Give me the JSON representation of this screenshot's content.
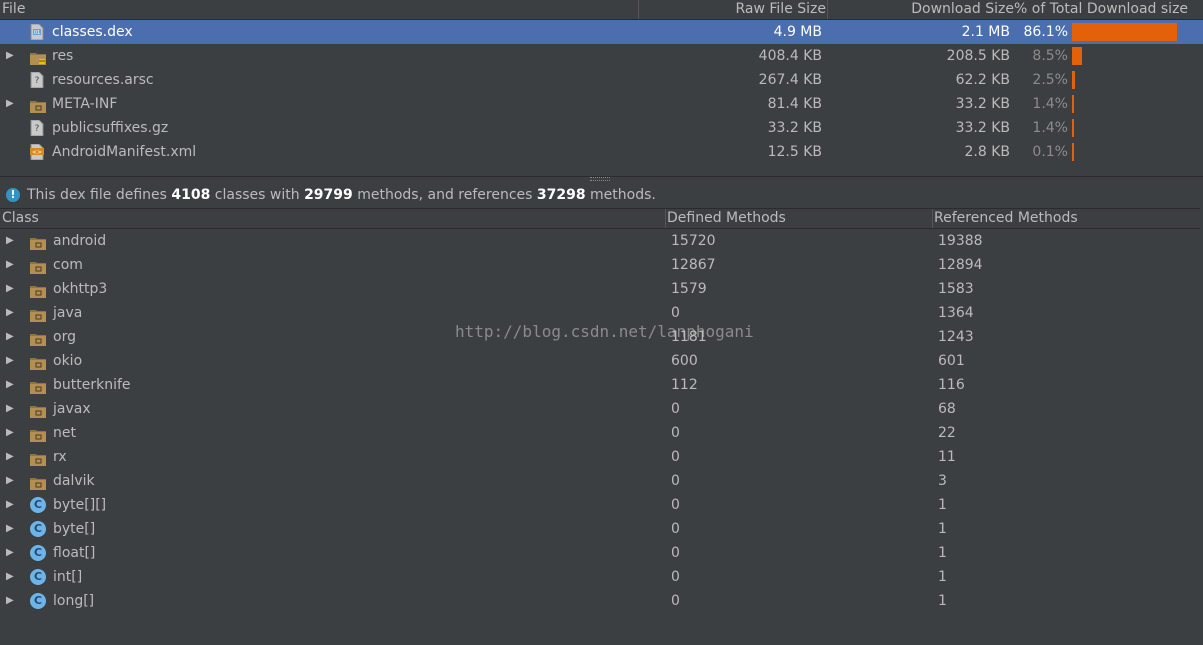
{
  "file_table": {
    "headers": {
      "file": "File",
      "raw_size": "Raw File Size",
      "download_size": "Download Size",
      "percent": "% of Total Download size"
    },
    "rows": [
      {
        "name": "classes.dex",
        "raw": "4.9 MB",
        "download": "2.1 MB",
        "percent": "86.1%",
        "fraction": 0.861,
        "expandable": false,
        "selected": true,
        "icon": "dex-file-icon"
      },
      {
        "name": "res",
        "raw": "408.4 KB",
        "download": "208.5 KB",
        "percent": "8.5%",
        "fraction": 0.085,
        "expandable": true,
        "selected": false,
        "icon": "resource-folder-icon"
      },
      {
        "name": "resources.arsc",
        "raw": "267.4 KB",
        "download": "62.2 KB",
        "percent": "2.5%",
        "fraction": 0.025,
        "expandable": false,
        "selected": false,
        "icon": "unknown-file-icon"
      },
      {
        "name": "META-INF",
        "raw": "81.4 KB",
        "download": "33.2 KB",
        "percent": "1.4%",
        "fraction": 0.014,
        "expandable": true,
        "selected": false,
        "icon": "folder-icon"
      },
      {
        "name": "publicsuffixes.gz",
        "raw": "33.2 KB",
        "download": "33.2 KB",
        "percent": "1.4%",
        "fraction": 0.014,
        "expandable": false,
        "selected": false,
        "icon": "unknown-file-icon"
      },
      {
        "name": "AndroidManifest.xml",
        "raw": "12.5 KB",
        "download": "2.8 KB",
        "percent": "0.1%",
        "fraction": 0.001,
        "expandable": false,
        "selected": false,
        "icon": "xml-file-icon"
      }
    ]
  },
  "info": {
    "t1": "This dex file defines ",
    "classes": "4108",
    "t2": " classes with ",
    "methods": "29799",
    "t3": " methods, and references ",
    "refs": "37298",
    "t4": " methods."
  },
  "class_table": {
    "headers": {
      "class": "Class",
      "defined": "Defined Methods",
      "referenced": "Referenced Methods"
    },
    "rows": [
      {
        "name": "android",
        "defined": "15720",
        "referenced": "19388",
        "kind": "package"
      },
      {
        "name": "com",
        "defined": "12867",
        "referenced": "12894",
        "kind": "package"
      },
      {
        "name": "okhttp3",
        "defined": "1579",
        "referenced": "1583",
        "kind": "package"
      },
      {
        "name": "java",
        "defined": "0",
        "referenced": "1364",
        "kind": "package"
      },
      {
        "name": "org",
        "defined": "1181",
        "referenced": "1243",
        "kind": "package"
      },
      {
        "name": "okio",
        "defined": "600",
        "referenced": "601",
        "kind": "package"
      },
      {
        "name": "butterknife",
        "defined": "112",
        "referenced": "116",
        "kind": "package"
      },
      {
        "name": "javax",
        "defined": "0",
        "referenced": "68",
        "kind": "package"
      },
      {
        "name": "net",
        "defined": "0",
        "referenced": "22",
        "kind": "package"
      },
      {
        "name": "rx",
        "defined": "0",
        "referenced": "11",
        "kind": "package"
      },
      {
        "name": "dalvik",
        "defined": "0",
        "referenced": "3",
        "kind": "package"
      },
      {
        "name": "byte[][]",
        "defined": "0",
        "referenced": "1",
        "kind": "class"
      },
      {
        "name": "byte[]",
        "defined": "0",
        "referenced": "1",
        "kind": "class"
      },
      {
        "name": "float[]",
        "defined": "0",
        "referenced": "1",
        "kind": "class"
      },
      {
        "name": "int[]",
        "defined": "0",
        "referenced": "1",
        "kind": "class"
      },
      {
        "name": "long[]",
        "defined": "0",
        "referenced": "1",
        "kind": "class"
      }
    ]
  },
  "watermark": "http://blog.csdn.net/lanphogani",
  "colors": {
    "accent_bar": "#e36209",
    "selection": "#4b6eaf",
    "background": "#3c3f41"
  }
}
